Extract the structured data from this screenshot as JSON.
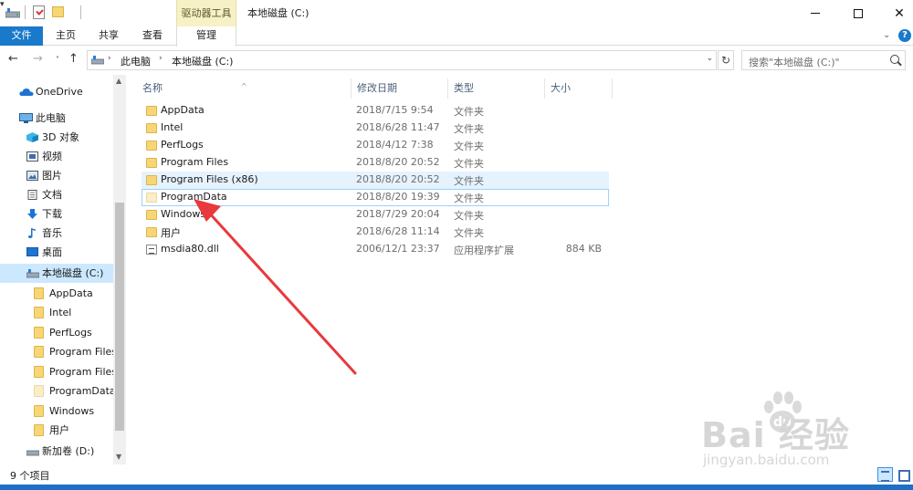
{
  "titlebar": {
    "contextual_tab": "驱动器工具",
    "title": "本地磁盘 (C:)",
    "minimize": "—",
    "maximize": "□",
    "close": "✕",
    "dropdown": "▾"
  },
  "ribbon": {
    "tabs": [
      "文件",
      "主页",
      "共享",
      "查看",
      "管理"
    ],
    "expand": "⌄",
    "help": "?"
  },
  "nav": {
    "back": "←",
    "forward": "→",
    "recent": "˅",
    "up": "↑",
    "breadcrumb": [
      "此电脑",
      "本地磁盘 (C:)"
    ],
    "separator": "›",
    "dropdown": "⌄",
    "refresh": "↻",
    "search_placeholder": "搜索\"本地磁盘 (C:)\""
  },
  "sidebar": {
    "items": [
      {
        "label": "OneDrive",
        "icon": "cloud-icon"
      },
      {
        "label": "此电脑",
        "icon": "computer-icon"
      },
      {
        "label": "3D 对象",
        "icon": "cube-icon"
      },
      {
        "label": "视频",
        "icon": "video-icon"
      },
      {
        "label": "图片",
        "icon": "picture-icon"
      },
      {
        "label": "文档",
        "icon": "document-icon"
      },
      {
        "label": "下载",
        "icon": "download-icon"
      },
      {
        "label": "音乐",
        "icon": "music-icon"
      },
      {
        "label": "桌面",
        "icon": "desktop-icon"
      },
      {
        "label": "本地磁盘 (C:)",
        "icon": "drive-icon"
      },
      {
        "label": "AppData",
        "icon": "folder-icon"
      },
      {
        "label": "Intel",
        "icon": "folder-icon"
      },
      {
        "label": "PerfLogs",
        "icon": "folder-icon"
      },
      {
        "label": "Program Files",
        "icon": "folder-icon"
      },
      {
        "label": "Program Files",
        "icon": "folder-icon"
      },
      {
        "label": "ProgramData",
        "icon": "folder-icon"
      },
      {
        "label": "Windows",
        "icon": "folder-icon"
      },
      {
        "label": "用户",
        "icon": "folder-icon"
      },
      {
        "label": "新加卷 (D:)",
        "icon": "drive-icon"
      }
    ],
    "scroll_up": "▲",
    "scroll_down": "▼"
  },
  "columns": {
    "name": "名称",
    "date": "修改日期",
    "type": "类型",
    "size": "大小",
    "sort_arrow": "^"
  },
  "files": [
    {
      "name": "AppData",
      "date": "2018/7/15 9:54",
      "type": "文件夹",
      "size": "",
      "icon": "folder-icon"
    },
    {
      "name": "Intel",
      "date": "2018/6/28 11:47",
      "type": "文件夹",
      "size": "",
      "icon": "folder-icon"
    },
    {
      "name": "PerfLogs",
      "date": "2018/4/12 7:38",
      "type": "文件夹",
      "size": "",
      "icon": "folder-icon"
    },
    {
      "name": "Program Files",
      "date": "2018/8/20 20:52",
      "type": "文件夹",
      "size": "",
      "icon": "folder-icon"
    },
    {
      "name": "Program Files (x86)",
      "date": "2018/8/20 20:52",
      "type": "文件夹",
      "size": "",
      "icon": "folder-icon"
    },
    {
      "name": "ProgramData",
      "date": "2018/8/20 19:39",
      "type": "文件夹",
      "size": "",
      "icon": "folder-icon"
    },
    {
      "name": "Windows",
      "date": "2018/7/29 20:04",
      "type": "文件夹",
      "size": "",
      "icon": "folder-icon"
    },
    {
      "name": "用户",
      "date": "2018/6/28 11:14",
      "type": "文件夹",
      "size": "",
      "icon": "folder-icon"
    },
    {
      "name": "msdia80.dll",
      "date": "2006/12/1 23:37",
      "type": "应用程序扩展",
      "size": "884 KB",
      "icon": "dll-file-icon"
    }
  ],
  "status": {
    "item_count": "9 个项目"
  },
  "watermark": {
    "brand": "Bai  经验",
    "url": "jingyan.baidu.com"
  },
  "colors": {
    "accent": "#1979ca",
    "selection": "#cce8ff",
    "hover": "#e5f3ff",
    "contextual_tab": "#f7f1c7",
    "annotation_arrow": "#e8393c"
  }
}
